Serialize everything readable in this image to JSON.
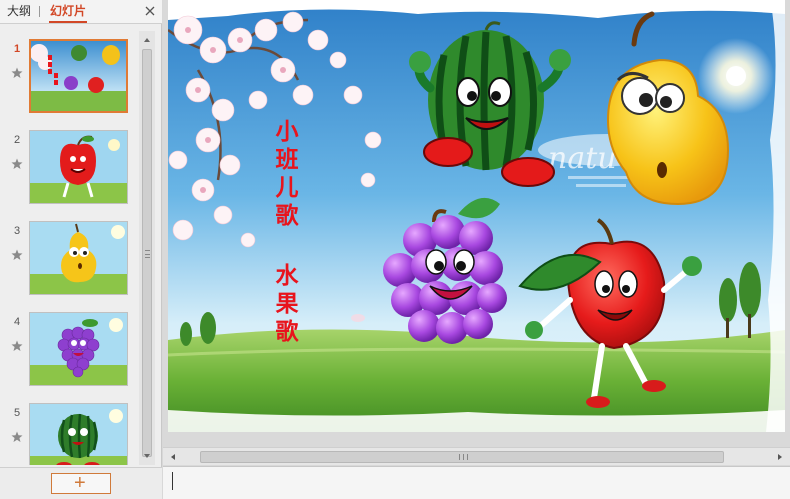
{
  "left_pane": {
    "tabs": [
      {
        "label": "大纲",
        "active": false
      },
      {
        "label": "幻灯片",
        "active": true
      }
    ],
    "close_icon": "close-icon",
    "add_button_label": "+"
  },
  "slides": [
    {
      "number": "1",
      "active": true,
      "content": "title-fruits"
    },
    {
      "number": "2",
      "active": false,
      "content": "apple"
    },
    {
      "number": "3",
      "active": false,
      "content": "pear"
    },
    {
      "number": "4",
      "active": false,
      "content": "grape"
    },
    {
      "number": "5",
      "active": false,
      "content": "watermelon"
    }
  ],
  "current_slide": {
    "title_line1": [
      "小",
      "班",
      "儿",
      "歌"
    ],
    "title_line2": [
      "水",
      "果",
      "歌"
    ],
    "background_word": "natu",
    "characters": [
      "watermelon",
      "pear",
      "grape",
      "apple"
    ]
  },
  "colors": {
    "accent": "#d24726",
    "title_red": "#e8141c",
    "sky_blue": "#4f9fd8",
    "grass_green": "#6cae3a"
  }
}
